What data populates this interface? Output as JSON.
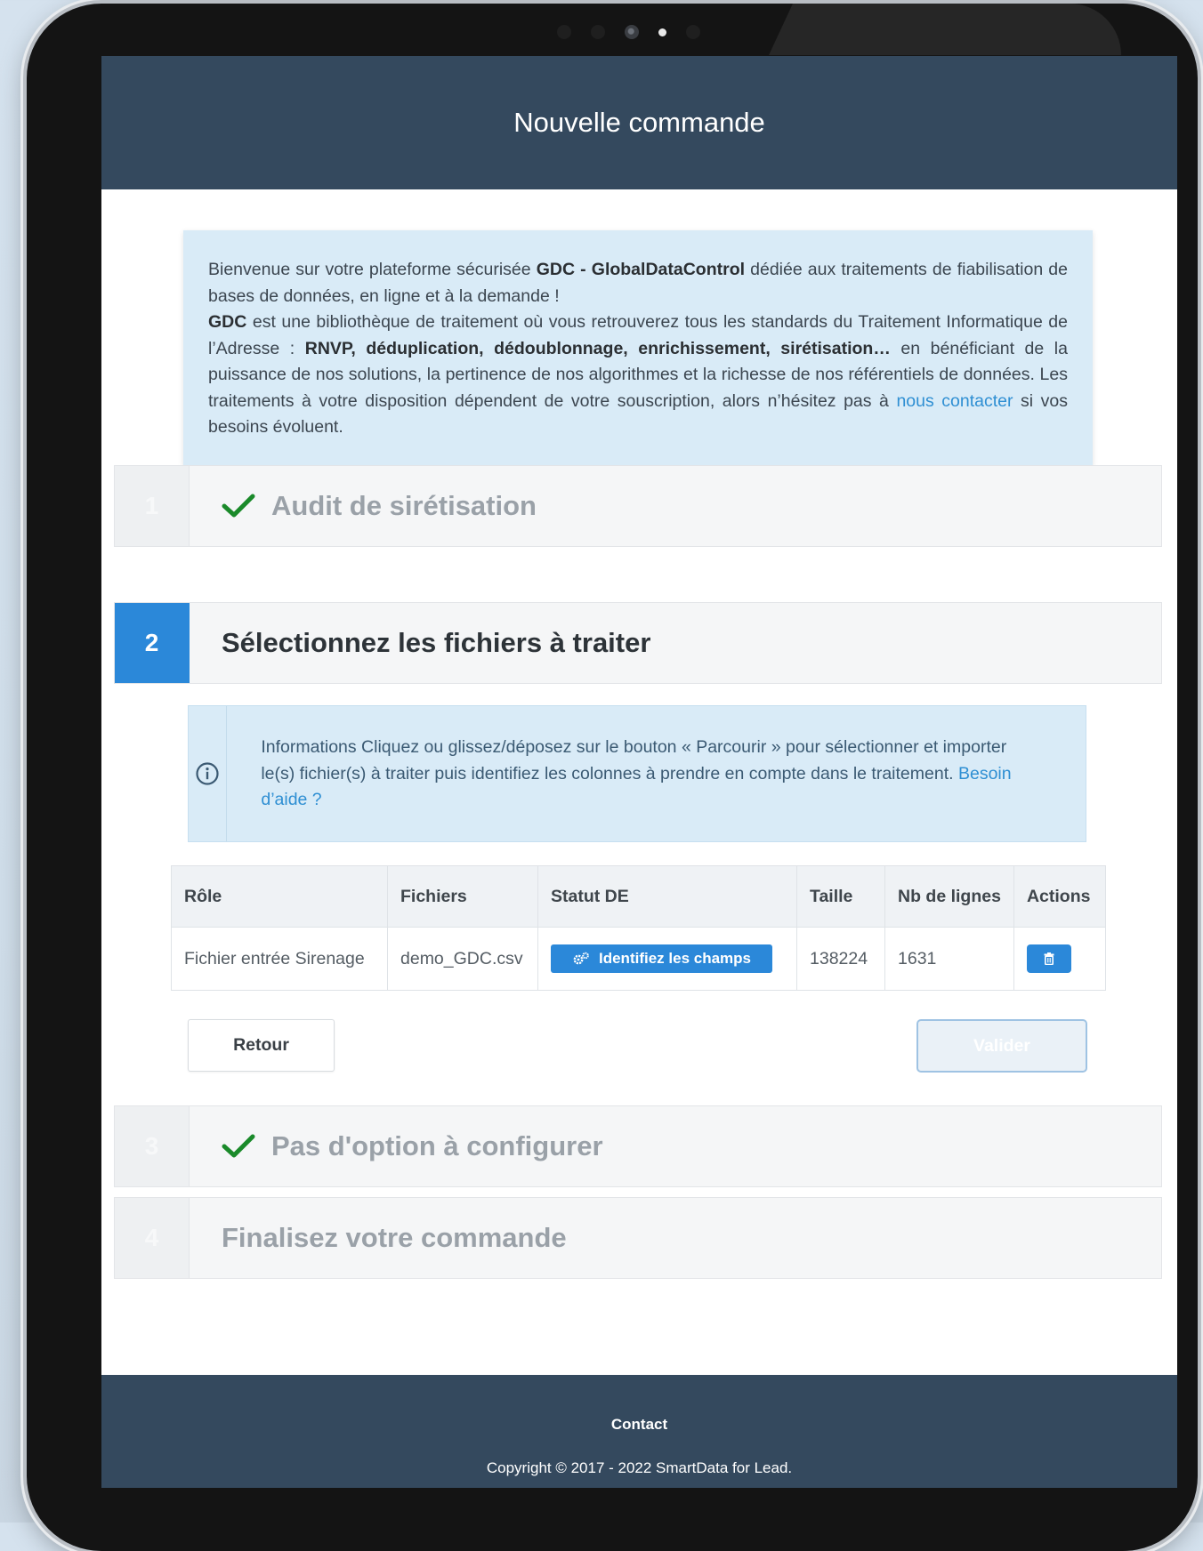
{
  "header": {
    "title": "Nouvelle commande"
  },
  "welcome": {
    "t1": "Bienvenue sur votre plateforme sécurisée ",
    "b1": "GDC - GlobalDataControl",
    "t2": " dédiée aux traitements de fiabilisation de bases de données, en ligne et à la demande !",
    "b2": "GDC",
    "t3": " est une bibliothèque de traitement où vous retrouverez tous les standards du Traitement Informatique de l’Adresse : ",
    "b3": "RNVP, déduplication, dédoublonnage, enrichissement, sirétisation…",
    "t4": " en bénéficiant de la puissance de nos solutions, la pertinence de nos algorithmes et la richesse de nos référentiels de données. Les traitements à votre disposition dépendent de votre souscription, alors n’hésitez pas à ",
    "link": "nous contacter",
    "t5": " si vos besoins évoluent."
  },
  "steps": [
    {
      "number": "1",
      "title": "Audit de sirétisation",
      "state": "done"
    },
    {
      "number": "2",
      "title": "Sélectionnez les fichiers à traiter",
      "state": "active"
    },
    {
      "number": "3",
      "title": "Pas d'option à configurer",
      "state": "done"
    },
    {
      "number": "4",
      "title": "Finalisez votre commande",
      "state": "pending"
    }
  ],
  "info": {
    "text": "Informations Cliquez ou glissez/déposez sur le bouton « Parcourir » pour sélectionner et importer le(s) fichier(s) à traiter puis identifiez les colonnes à prendre en compte dans le traitement. ",
    "link": "Besoin d’aide ?",
    "icon": "info-circle-icon"
  },
  "table": {
    "headers": [
      "Rôle",
      "Fichiers",
      "Statut DE",
      "Taille",
      "Nb de lignes",
      "Actions"
    ],
    "rows": [
      {
        "role": "Fichier entrée Sirenage",
        "file": "demo_GDC.csv",
        "status_button": "Identifiez les champs",
        "size": "138224",
        "lines": "1631"
      }
    ]
  },
  "buttons": {
    "back": "Retour",
    "validate": "Valider"
  },
  "footer": {
    "contact": "Contact",
    "copyright": "Copyright © 2017 - 2022 SmartData for Lead."
  },
  "colors": {
    "header_bg": "#34495e",
    "accent": "#2b88d9",
    "info_bg": "#d9ebf7",
    "check": "#1a8a2a"
  }
}
